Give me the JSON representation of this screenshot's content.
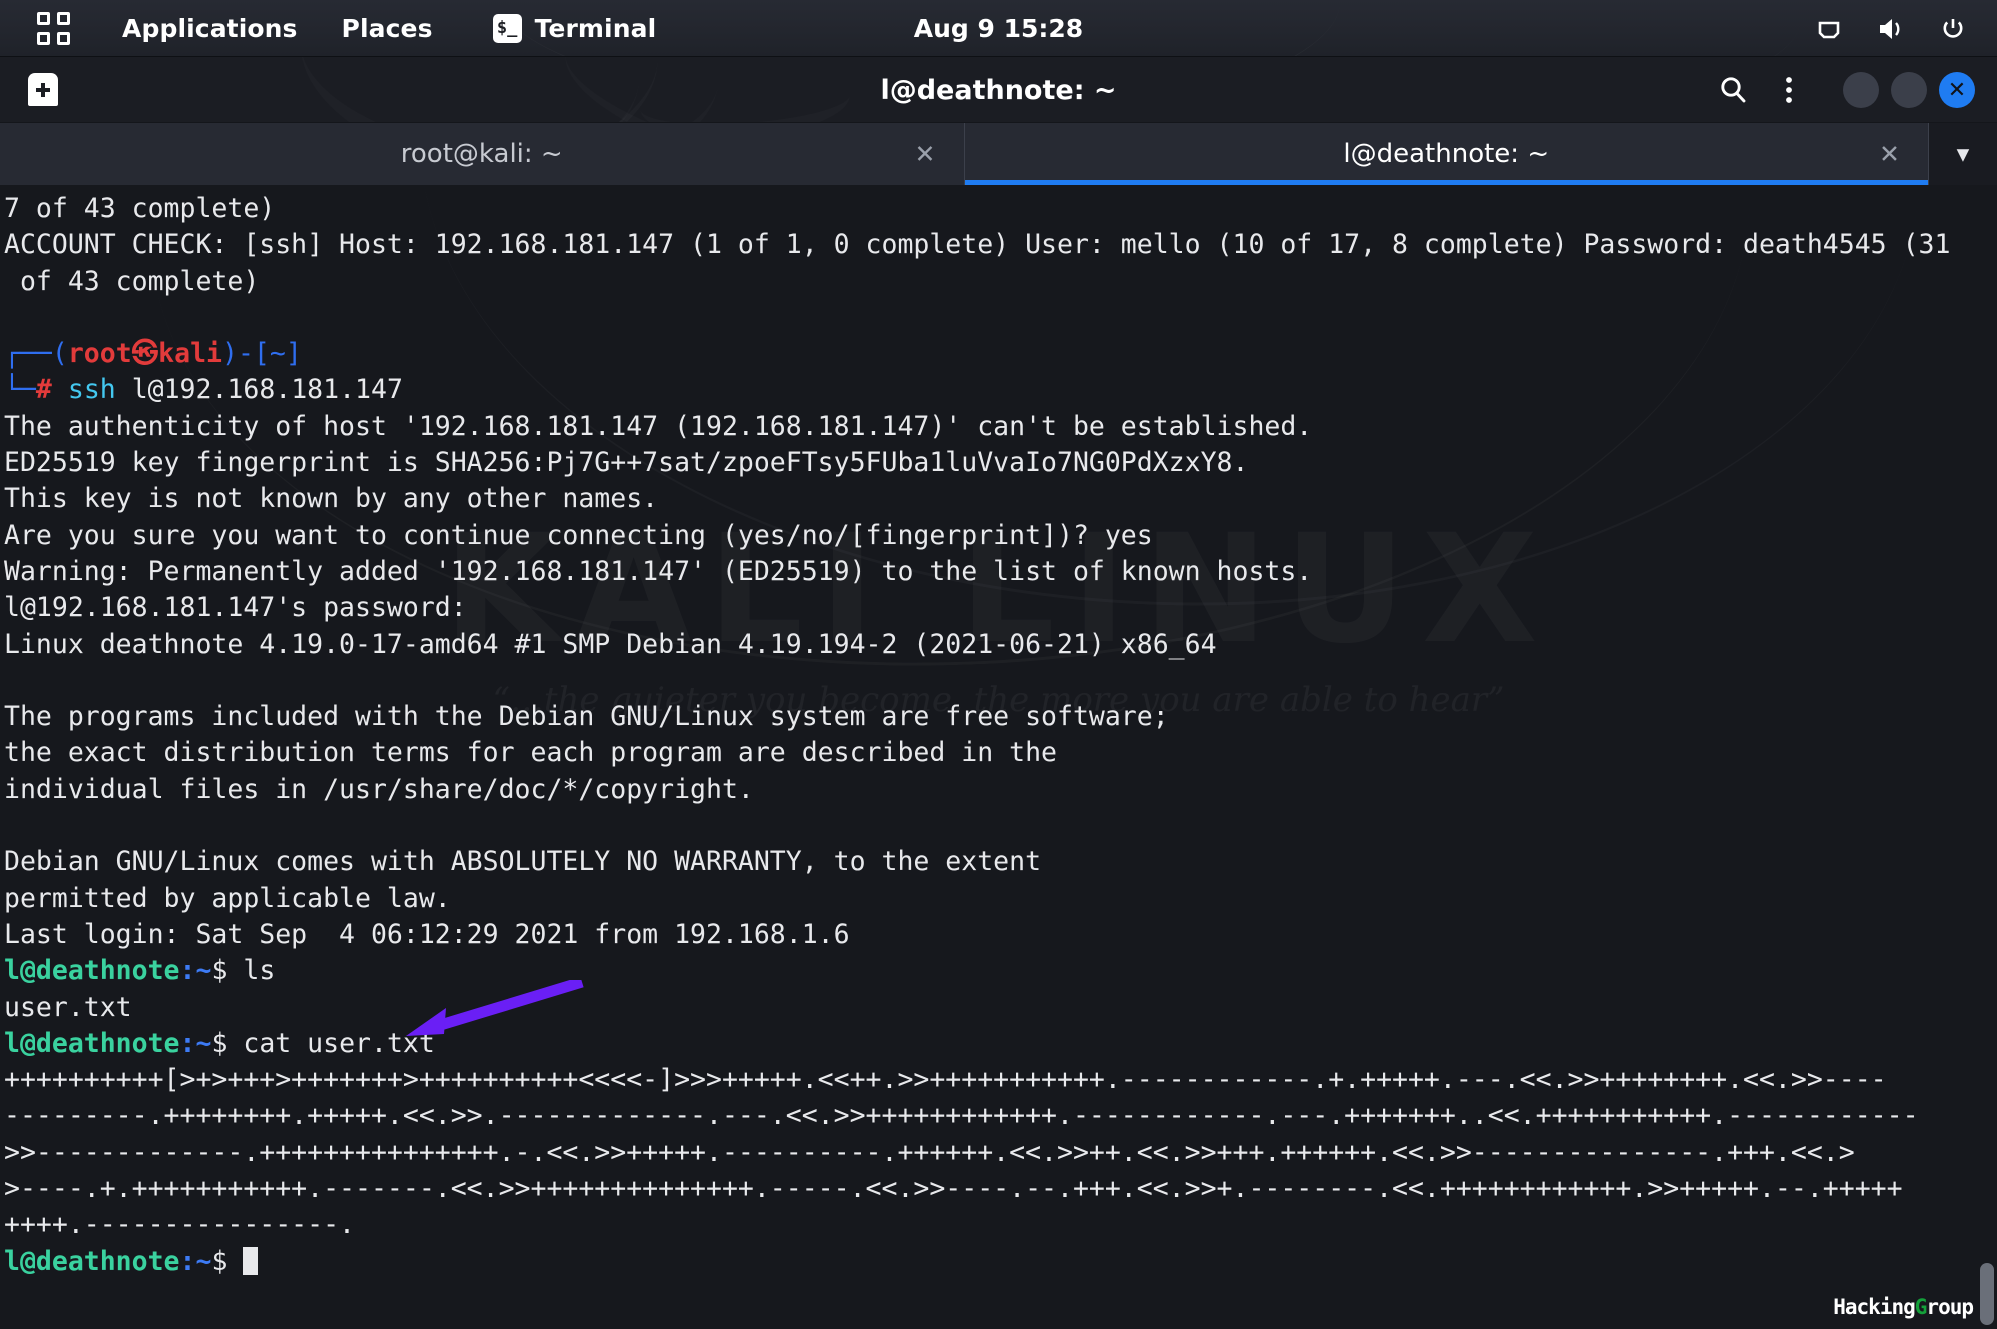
{
  "panel": {
    "app_grid_icon": "app-grid-icon",
    "applications_label": "Applications",
    "places_label": "Places",
    "terminal_label": "Terminal",
    "terminal_icon": "terminal-prompt-icon",
    "clock": "Aug 9  15:28",
    "tray": [
      {
        "name": "network-icon",
        "glyph": "network"
      },
      {
        "name": "volume-icon",
        "glyph": "volume"
      },
      {
        "name": "power-icon",
        "glyph": "power"
      }
    ]
  },
  "window": {
    "title": "l@deathnote: ~",
    "new_tab_icon": "new-tab-icon",
    "search_icon": "search-icon",
    "menu_icon": "overflow-menu-icon",
    "minimize_label": "",
    "maximize_label": "",
    "close_label": "✕",
    "accent_color": "#1f7cf2"
  },
  "tabs": [
    {
      "label": "root@kali: ~",
      "active": false,
      "close": "✕"
    },
    {
      "label": "l@deathnote: ~",
      "active": true,
      "close": "✕"
    }
  ],
  "tab_menu": {
    "icon": "chevron-down-icon",
    "glyph": "▼"
  },
  "terminal": {
    "scrollback_tail": "7 of 43 complete)",
    "account_check_line1": "ACCOUNT CHECK: [ssh] Host: 192.168.181.147 (1 of 1, 0 complete) User: mello (10 of 17, 8 complete) Password: death4545 (31",
    "account_check_line2": " of 43 complete)",
    "kali_prompt": {
      "branch_top": "┌──",
      "branch_bottom": "└─",
      "open_paren": "(",
      "user_host": "root㉿kali",
      "close_paren": ")-",
      "cwd": "[~]",
      "hash": "#",
      "command_name": "ssh",
      "command_args": " l@192.168.181.147"
    },
    "ssh_output": [
      "The authenticity of host '192.168.181.147 (192.168.181.147)' can't be established.",
      "ED25519 key fingerprint is SHA256:Pj7G++7sat/zpoeFTsy5FUba1luVvaIo7NG0PdXzxY8.",
      "This key is not known by any other names.",
      "Are you sure you want to continue connecting (yes/no/[fingerprint])? yes",
      "Warning: Permanently added '192.168.181.147' (ED25519) to the list of known hosts.",
      "l@192.168.181.147's password:",
      "Linux deathnote 4.19.0-17-amd64 #1 SMP Debian 4.19.194-2 (2021-06-21) x86_64",
      "",
      "The programs included with the Debian GNU/Linux system are free software;",
      "the exact distribution terms for each program are described in the",
      "individual files in /usr/share/doc/*/copyright.",
      "",
      "Debian GNU/Linux comes with ABSOLUTELY NO WARRANTY, to the extent",
      "permitted by applicable law.",
      "Last login: Sat Sep  4 06:12:29 2021 from 192.168.1.6"
    ],
    "remote_prompt": {
      "user_host": "l@deathnote",
      "colon": ":",
      "cwd": "~",
      "dollar": "$"
    },
    "commands": [
      {
        "cmd": " ls",
        "output": [
          "user.txt"
        ]
      },
      {
        "cmd": " cat user.txt",
        "output": [
          "++++++++++[>+>+++>+++++++>++++++++++<<<<-]>>>+++++.<<++.>>+++++++++++.------------.+.+++++.---.<<.>>++++++++.<<.>>----",
          "---------.++++++++.+++++.<<.>>.-------------.---.<<.>>++++++++++++.------------.---.+++++++..<<.+++++++++++.------------",
          ">>-------------.+++++++++++++++.-.<<.>>+++++.----------.++++++.<<.>>++.<<.>>+++.++++++.<<.>>---------------.+++.<<.>",
          ">----.+.+++++++++++.-------.<<.>>++++++++++++++.-----.<<.>>----.--.+++.<<.>>+.--------.<<.++++++++++++.>>+++++.--.+++++",
          "++++.----------------."
        ]
      }
    ],
    "final_prompt_cursor": "cursor-block"
  },
  "watermarks": {
    "kali_text": "KALI LINUX",
    "kali_tagline": "“…the quieter you become, the more you are able to hear”",
    "brand_prefix": "Hacking",
    "brand_accent": "G",
    "brand_suffix": "roup",
    "brand_accent_color": "#14a03a"
  },
  "annotation": {
    "arrow_name": "purple-annotation-arrow",
    "arrow_color": "#6a1ff5",
    "points_at": "cat user.txt"
  }
}
